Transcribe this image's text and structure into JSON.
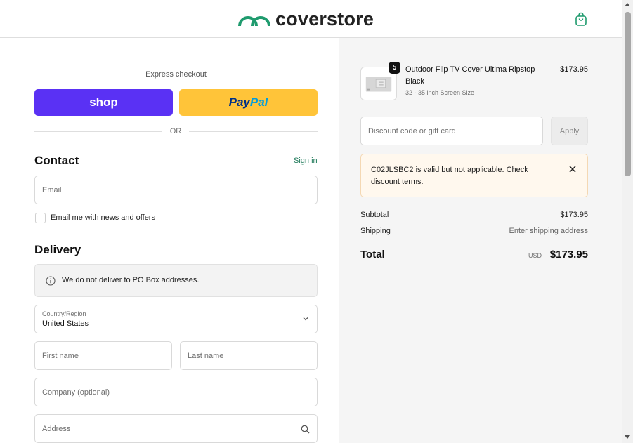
{
  "header": {
    "logo_text": "coverstore",
    "brand_color": "#1f9b6e"
  },
  "express": {
    "title": "Express checkout",
    "shop_label": "shop",
    "paypal_pay": "Pay",
    "paypal_pal": "Pal",
    "or_label": "OR"
  },
  "contact": {
    "title": "Contact",
    "signin_label": "Sign in",
    "email_placeholder": "Email",
    "newsletter_label": "Email me with news and offers"
  },
  "delivery": {
    "title": "Delivery",
    "notice": "We do not deliver to PO Box addresses.",
    "country_label": "Country/Region",
    "country_value": "United States",
    "first_name_placeholder": "First name",
    "last_name_placeholder": "Last name",
    "company_placeholder": "Company (optional)",
    "address_placeholder": "Address"
  },
  "order": {
    "product_name": "Outdoor Flip TV Cover Ultima Ripstop Black",
    "product_sub": "32 - 35 inch Screen Size",
    "product_price": "$173.95",
    "quantity": "5"
  },
  "discount": {
    "placeholder": "Discount code or gift card",
    "apply_label": "Apply",
    "alert_text": "C02JLSBC2 is valid but not applicable. Check discount terms."
  },
  "summary": {
    "subtotal_label": "Subtotal",
    "subtotal_value": "$173.95",
    "shipping_label": "Shipping",
    "shipping_value": "Enter shipping address",
    "total_label": "Total",
    "total_currency": "USD",
    "total_value": "$173.95"
  }
}
